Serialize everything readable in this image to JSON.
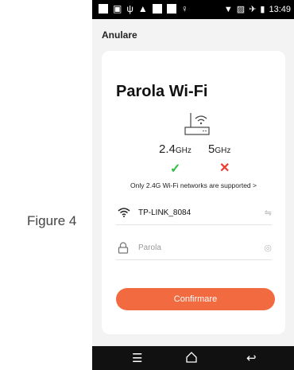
{
  "figure": {
    "caption": "Figure 4"
  },
  "status_bar": {
    "time": "13:49",
    "left_icons": [
      "notification-square-icon",
      "gallery-icon",
      "usb-icon",
      "warning-icon",
      "notification-square-icon",
      "notification-square-icon",
      "location-icon"
    ],
    "right_icons": [
      "wifi-signal-icon",
      "no-sim-icon",
      "airplane-icon",
      "battery-icon"
    ]
  },
  "header": {
    "cancel_label": "Anulare"
  },
  "card": {
    "title": "Parola Wi-Fi",
    "router_icon": "router-wifi-icon",
    "bands": [
      {
        "number": "2.4",
        "unit": "GHz",
        "supported": true,
        "mark_icon": "check-icon"
      },
      {
        "number": "5",
        "unit": "GHz",
        "supported": false,
        "mark_icon": "cross-icon"
      }
    ],
    "supported_notice": "Only 2.4G Wi-Fi networks are supported >",
    "wifi_row": {
      "icon": "wifi-icon",
      "ssid": "TP-LINK_8084",
      "action_icon": "swap-arrows-icon"
    },
    "password_row": {
      "icon": "lock-icon",
      "placeholder": "Parola",
      "action_icon": "eye-icon"
    },
    "confirm_label": "Confirmare"
  },
  "nav_bar": {
    "icons": [
      "menu-icon",
      "home-icon",
      "back-icon"
    ]
  },
  "colors": {
    "accent": "#f26a3f",
    "success": "#2fbf45",
    "error": "#ee3b2f"
  }
}
